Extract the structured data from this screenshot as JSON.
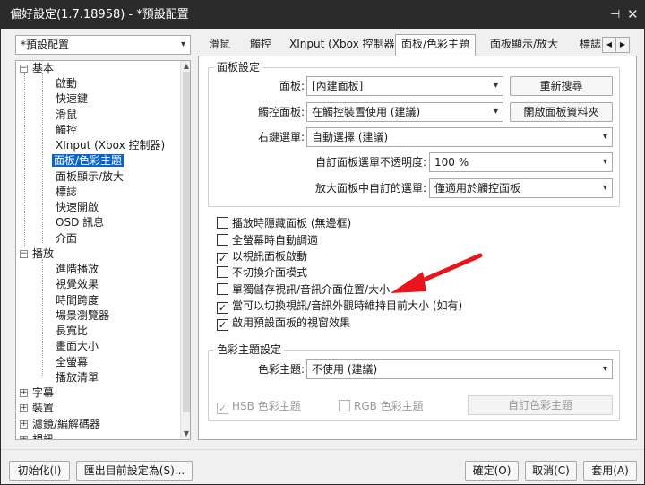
{
  "window": {
    "title": "偏好設定(1.7.18958) - *預設配置",
    "pin_glyph": "⊣",
    "close_glyph": "✕"
  },
  "profile_select": {
    "value": "*預設配置"
  },
  "tree": {
    "groups": [
      {
        "label": "基本",
        "expander": "−",
        "items": [
          "啟動",
          "快速鍵",
          "滑鼠",
          "觸控",
          "XInput (Xbox 控制器)",
          "面板/色彩主題",
          "面板顯示/放大",
          "標誌",
          "快速開啟",
          "OSD 訊息",
          "介面"
        ]
      },
      {
        "label": "播放",
        "expander": "−",
        "items": [
          "進階播放",
          "視覺效果",
          "時間跨度",
          "場景瀏覽器",
          "長寬比",
          "畫面大小",
          "全螢幕",
          "播放清單"
        ]
      },
      {
        "label": "字幕",
        "expander": "+"
      },
      {
        "label": "裝置",
        "expander": "+"
      },
      {
        "label": "濾鏡/編解碼器",
        "expander": "+"
      },
      {
        "label": "視訊",
        "expander": "+"
      }
    ],
    "selected": "面板/色彩主題"
  },
  "tabs": {
    "items": [
      "滑鼠",
      "觸控",
      "XInput (Xbox 控制器)",
      "面板/色彩主題",
      "面板顯示/放大",
      "標誌"
    ],
    "active": "面板/色彩主題",
    "prev_arrow": "◀",
    "next_arrow": "▶"
  },
  "panel_settings": {
    "group_title": "面板設定",
    "panel_label": "面板:",
    "panel_value": "[內建面板]",
    "rescan_button": "重新搜尋",
    "touch_label": "觸控面板:",
    "touch_value": "在觸控裝置使用 (建議)",
    "open_folder_button": "開啟面板資料夾",
    "context_label": "右鍵選單:",
    "context_value": "自動選擇 (建議)",
    "opacity_label": "自訂面板選單不透明度:",
    "opacity_value": "100 %",
    "zoom_label": "放大面板中自訂的選單:",
    "zoom_value": "僅適用於觸控面板"
  },
  "checkboxes": [
    {
      "label": "播放時隱藏面板 (無邊框)",
      "checked": false
    },
    {
      "label": "全螢幕時自動調適",
      "checked": false
    },
    {
      "label": "以視訊面板啟動",
      "checked": true
    },
    {
      "label": "不切換介面模式",
      "checked": false
    },
    {
      "label": "單獨儲存視訊/音訊介面位置/大小",
      "checked": false
    },
    {
      "label": "當可以切換視訊/音訊外觀時維持目前大小 (如有)",
      "checked": true
    },
    {
      "label": "啟用預設面板的視窗效果",
      "checked": true
    }
  ],
  "color_theme": {
    "group_title": "色彩主題設定",
    "theme_label": "色彩主題:",
    "theme_value": "不使用 (建議)",
    "hsb_label": "HSB 色彩主題",
    "hsb_checked": true,
    "rgb_label": "RGB 色彩主題",
    "rgb_checked": false,
    "custom_button": "自訂色彩主題"
  },
  "footer": {
    "init_button": "初始化(I)",
    "export_button": "匯出目前設定為(S)...",
    "ok_button": "確定(O)",
    "cancel_button": "取消(C)",
    "apply_button": "套用(A)"
  },
  "colors": {
    "titlebar": "#2b2b2b",
    "selection": "#0a64c8",
    "annotation_arrow": "#e8161c"
  },
  "icons": {
    "dropdown": "▾",
    "check": "✓"
  }
}
